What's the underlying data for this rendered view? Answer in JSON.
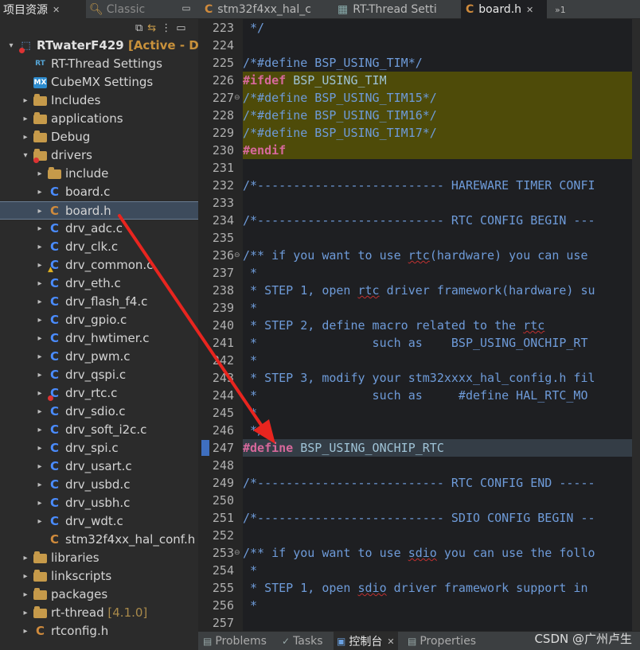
{
  "left_panel": {
    "tabs": [
      {
        "label": "项目资源",
        "close": "✕"
      },
      {
        "label": "Classic"
      }
    ],
    "tree": [
      {
        "label": "RTwaterF429",
        "extra": "[Active - De",
        "type": "project",
        "depth": 0,
        "arrow": "▾",
        "error": true
      },
      {
        "label": "RT-Thread Settings",
        "type": "rt",
        "depth": 1
      },
      {
        "label": "CubeMX Settings",
        "type": "mx",
        "depth": 1
      },
      {
        "label": "Includes",
        "type": "folder",
        "depth": 1,
        "arrow": "▸"
      },
      {
        "label": "applications",
        "type": "folder",
        "depth": 1,
        "arrow": "▸"
      },
      {
        "label": "Debug",
        "type": "folder",
        "depth": 1,
        "arrow": "▸"
      },
      {
        "label": "drivers",
        "type": "folder",
        "depth": 1,
        "arrow": "▾",
        "error": true
      },
      {
        "label": "include",
        "type": "folder",
        "depth": 2,
        "arrow": "▸"
      },
      {
        "label": "board.c",
        "type": "c",
        "depth": 2,
        "arrow": "▸"
      },
      {
        "label": "board.h",
        "type": "h",
        "depth": 2,
        "arrow": "▸",
        "selected": true
      },
      {
        "label": "drv_adc.c",
        "type": "c",
        "depth": 2,
        "arrow": "▸"
      },
      {
        "label": "drv_clk.c",
        "type": "c",
        "depth": 2,
        "arrow": "▸"
      },
      {
        "label": "drv_common.c",
        "type": "c",
        "depth": 2,
        "arrow": "▸",
        "warning": true
      },
      {
        "label": "drv_eth.c",
        "type": "c",
        "depth": 2,
        "arrow": "▸"
      },
      {
        "label": "drv_flash_f4.c",
        "type": "c",
        "depth": 2,
        "arrow": "▸"
      },
      {
        "label": "drv_gpio.c",
        "type": "c",
        "depth": 2,
        "arrow": "▸"
      },
      {
        "label": "drv_hwtimer.c",
        "type": "c",
        "depth": 2,
        "arrow": "▸"
      },
      {
        "label": "drv_pwm.c",
        "type": "c",
        "depth": 2,
        "arrow": "▸"
      },
      {
        "label": "drv_qspi.c",
        "type": "c",
        "depth": 2,
        "arrow": "▸"
      },
      {
        "label": "drv_rtc.c",
        "type": "c",
        "depth": 2,
        "arrow": "▸",
        "error": true
      },
      {
        "label": "drv_sdio.c",
        "type": "c",
        "depth": 2,
        "arrow": "▸"
      },
      {
        "label": "drv_soft_i2c.c",
        "type": "c",
        "depth": 2,
        "arrow": "▸"
      },
      {
        "label": "drv_spi.c",
        "type": "c",
        "depth": 2,
        "arrow": "▸"
      },
      {
        "label": "drv_usart.c",
        "type": "c",
        "depth": 2,
        "arrow": "▸"
      },
      {
        "label": "drv_usbd.c",
        "type": "c",
        "depth": 2,
        "arrow": "▸"
      },
      {
        "label": "drv_usbh.c",
        "type": "c",
        "depth": 2,
        "arrow": "▸"
      },
      {
        "label": "drv_wdt.c",
        "type": "c",
        "depth": 2,
        "arrow": "▸"
      },
      {
        "label": "stm32f4xx_hal_conf.h",
        "type": "h",
        "depth": 2,
        "arrow": ""
      },
      {
        "label": "libraries",
        "type": "folder",
        "depth": 1,
        "arrow": "▸"
      },
      {
        "label": "linkscripts",
        "type": "folder",
        "depth": 1,
        "arrow": "▸"
      },
      {
        "label": "packages",
        "type": "folder",
        "depth": 1,
        "arrow": "▸"
      },
      {
        "label": "rt-thread",
        "extra": "[4.1.0]",
        "type": "folder",
        "depth": 1,
        "arrow": "▸"
      },
      {
        "label": "rtconfig.h",
        "type": "h",
        "depth": 1,
        "arrow": "▸"
      }
    ]
  },
  "editor": {
    "tabs": [
      {
        "label": "stm32f4xx_hal_c",
        "icon": "c"
      },
      {
        "label": "RT-Thread Setti",
        "icon": "cfg"
      },
      {
        "label": "board.h",
        "icon": "c",
        "active": true,
        "close": "✕"
      },
      {
        "label": "»1"
      }
    ],
    "lines": [
      {
        "n": "223",
        "html": " */"
      },
      {
        "n": "224",
        "html": ""
      },
      {
        "n": "225",
        "html": "/*#define BSP_USING_TIM*/"
      },
      {
        "n": "226",
        "kind": "ifdef",
        "parts": [
          [
            "kw",
            "#ifdef"
          ],
          [
            "mac",
            " BSP_USING_TIM"
          ]
        ]
      },
      {
        "n": "227",
        "kind": "ifdef",
        "fold": true,
        "html": "/*#define BSP_USING_TIM15*/"
      },
      {
        "n": "228",
        "kind": "ifdef",
        "html": "/*#define BSP_USING_TIM16*/"
      },
      {
        "n": "229",
        "kind": "ifdef",
        "html": "/*#define BSP_USING_TIM17*/"
      },
      {
        "n": "230",
        "kind": "ifdef",
        "parts": [
          [
            "kw",
            "#endif"
          ]
        ]
      },
      {
        "n": "231",
        "html": ""
      },
      {
        "n": "232",
        "html": "/*-------------------------- HAREWARE TIMER CONFI"
      },
      {
        "n": "233",
        "html": ""
      },
      {
        "n": "234",
        "html": "/*-------------------------- RTC CONFIG BEGIN ---"
      },
      {
        "n": "235",
        "html": ""
      },
      {
        "n": "236",
        "fold": true,
        "parts": [
          [
            "",
            "/** if you want to use "
          ],
          [
            "sq",
            "rtc"
          ],
          [
            "",
            "(hardware) you can use"
          ]
        ]
      },
      {
        "n": "237",
        "html": " *"
      },
      {
        "n": "238",
        "parts": [
          [
            "",
            " * STEP 1, open "
          ],
          [
            "sq",
            "rtc"
          ],
          [
            "",
            " driver framework(hardware) su"
          ]
        ]
      },
      {
        "n": "239",
        "html": " *"
      },
      {
        "n": "240",
        "parts": [
          [
            "",
            " * STEP 2, define macro related to the "
          ],
          [
            "sq",
            "rtc"
          ]
        ]
      },
      {
        "n": "241",
        "html": " *                such as    BSP_USING_ONCHIP_RT"
      },
      {
        "n": "242",
        "html": " *"
      },
      {
        "n": "243",
        "html": " * STEP 3, modify your stm32xxxx_hal_config.h fil"
      },
      {
        "n": "244",
        "html": " *                such as     #define HAL_RTC_MO"
      },
      {
        "n": "245",
        "html": " *"
      },
      {
        "n": "246",
        "html": " */"
      },
      {
        "n": "247",
        "kind": "def",
        "parts": [
          [
            "kw",
            "#define"
          ],
          [
            "mac",
            " BSP_USING_ONCHIP_RTC"
          ]
        ]
      },
      {
        "n": "248",
        "html": ""
      },
      {
        "n": "249",
        "html": "/*-------------------------- RTC CONFIG END -----"
      },
      {
        "n": "250",
        "html": ""
      },
      {
        "n": "251",
        "html": "/*-------------------------- SDIO CONFIG BEGIN --"
      },
      {
        "n": "252",
        "html": ""
      },
      {
        "n": "253",
        "fold": true,
        "parts": [
          [
            "",
            "/** if you want to use "
          ],
          [
            "sq",
            "sdio"
          ],
          [
            "",
            " you can use the follo"
          ]
        ]
      },
      {
        "n": "254",
        "html": " *"
      },
      {
        "n": "255",
        "parts": [
          [
            "",
            " * STEP 1, open "
          ],
          [
            "sq",
            "sdio"
          ],
          [
            "",
            " driver framework support in"
          ]
        ]
      },
      {
        "n": "256",
        "html": " *"
      },
      {
        "n": "257",
        "html": ""
      }
    ]
  },
  "bottom_panel": {
    "tabs": [
      {
        "label": "Problems",
        "icon": "▤"
      },
      {
        "label": "Tasks",
        "icon": "✓"
      },
      {
        "label": "控制台",
        "icon": "▣",
        "active": true,
        "close": "✕"
      },
      {
        "label": "Properties",
        "icon": "▤"
      }
    ],
    "watermark": "CSDN @广州卢生"
  },
  "colors": {
    "annotation_arrow": "#e8251f",
    "ifdef_highlight": "#4e4b09",
    "define_highlight": "#343d46"
  }
}
